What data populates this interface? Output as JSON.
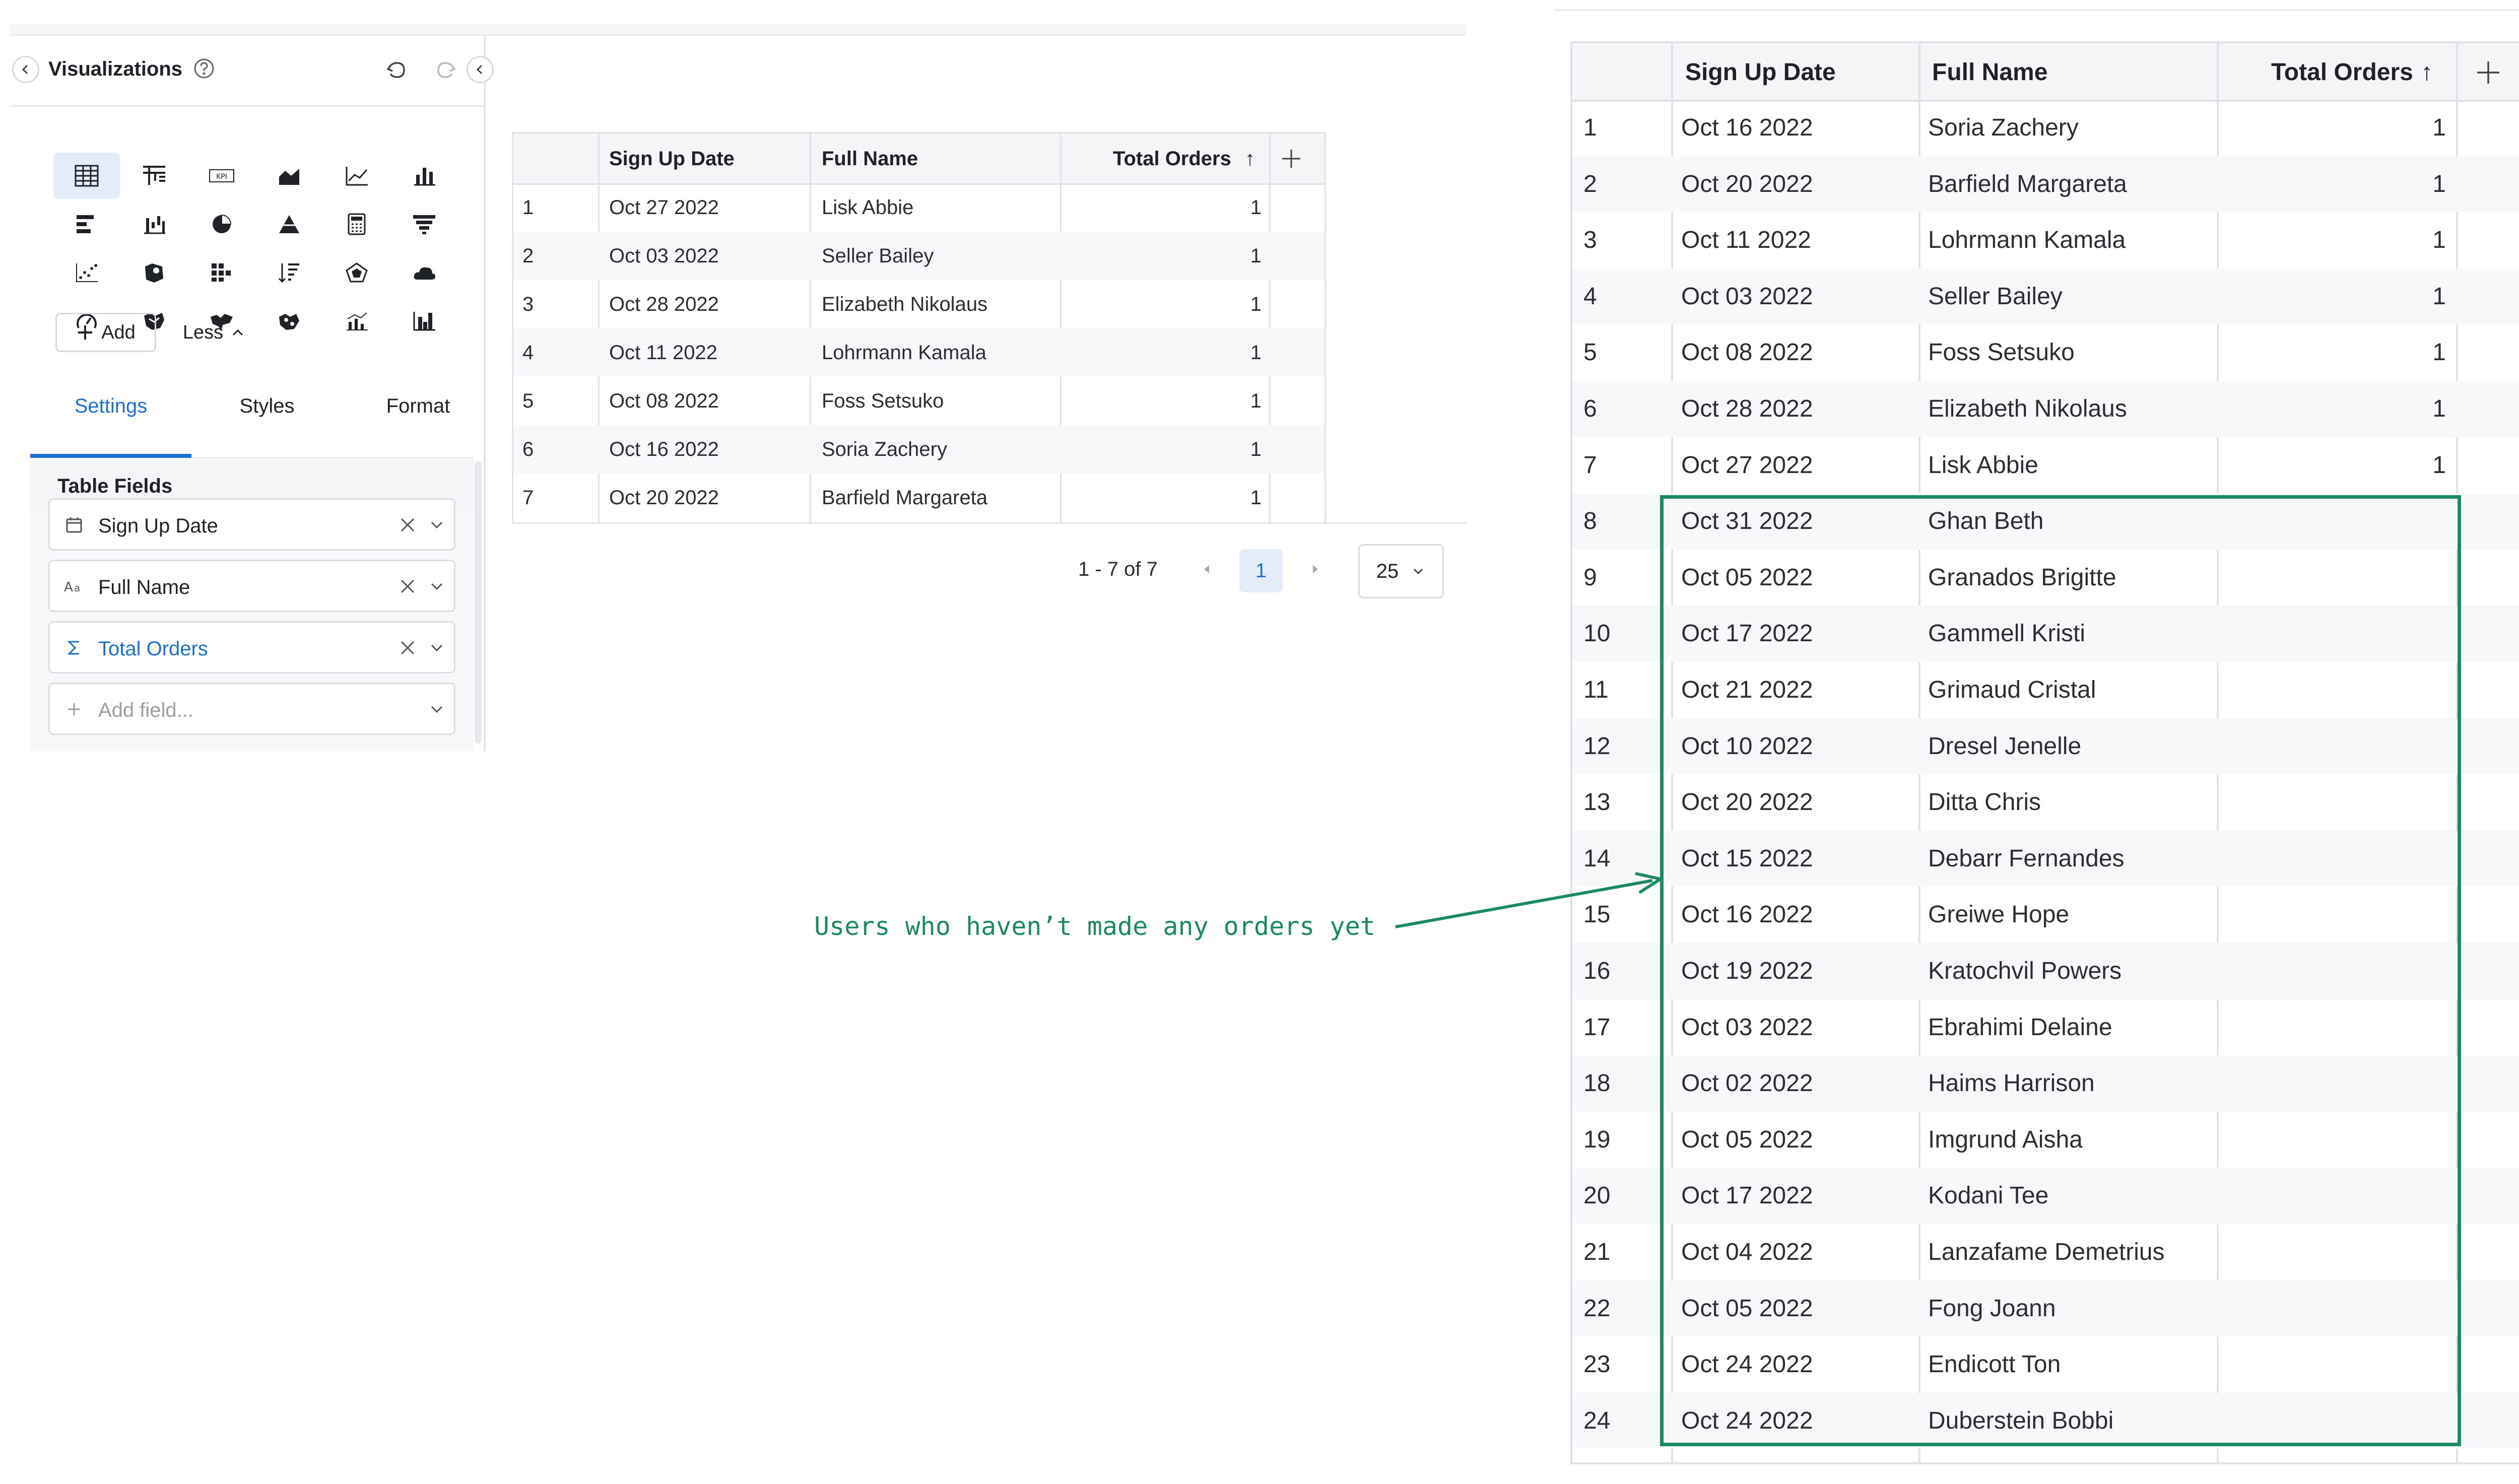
{
  "visualizations": {
    "title": "Visualizations",
    "icons": [
      "table-icon",
      "pivot-table-icon",
      "kpi-icon",
      "area-chart-icon",
      "line-chart-icon",
      "bar-chart-icon",
      "horizontal-bar-icon",
      "waterfall-icon",
      "pie-chart-icon",
      "pyramid-icon",
      "calculator-icon",
      "funnel-icon",
      "scatter-icon",
      "map-icon",
      "heatmap-icon",
      "sorted-bar-icon",
      "radar-icon",
      "word-cloud-icon",
      "gauge-icon",
      "map-region-icon",
      "world-map-icon",
      "bubble-map-icon",
      "combo-chart-icon",
      "histogram-icon"
    ],
    "add_label": "Add",
    "less_label": "Less",
    "tabs": [
      "Settings",
      "Styles",
      "Format"
    ],
    "active_tab": "Settings",
    "section_title": "Table Fields",
    "fields": [
      {
        "label": "Sign Up Date",
        "icon": "calendar-icon",
        "type": "dimension"
      },
      {
        "label": "Full Name",
        "icon": "text-type-icon",
        "type": "dimension"
      },
      {
        "label": "Total Orders",
        "icon": "sigma-icon",
        "type": "measure"
      }
    ],
    "add_field_placeholder": "Add field...",
    "accent": "#1f6fd1"
  },
  "center_table": {
    "columns": [
      "Sign Up Date",
      "Full Name",
      "Total Orders"
    ],
    "sort_indicator": "↑",
    "rows": [
      {
        "n": "1",
        "date": "Oct 27 2022",
        "name": "Lisk Abbie",
        "orders": "1"
      },
      {
        "n": "2",
        "date": "Oct 03 2022",
        "name": "Seller Bailey",
        "orders": "1"
      },
      {
        "n": "3",
        "date": "Oct 28 2022",
        "name": "Elizabeth Nikolaus",
        "orders": "1"
      },
      {
        "n": "4",
        "date": "Oct 11 2022",
        "name": "Lohrmann Kamala",
        "orders": "1"
      },
      {
        "n": "5",
        "date": "Oct 08 2022",
        "name": "Foss Setsuko",
        "orders": "1"
      },
      {
        "n": "6",
        "date": "Oct 16 2022",
        "name": "Soria Zachery",
        "orders": "1"
      },
      {
        "n": "7",
        "date": "Oct 20 2022",
        "name": "Barfield Margareta",
        "orders": "1"
      }
    ],
    "pagination": {
      "info": "1 - 7 of 7",
      "page": "1",
      "page_size": "25"
    }
  },
  "right_table": {
    "columns": [
      "Sign Up Date",
      "Full Name",
      "Total Orders"
    ],
    "sort_indicator": "↑",
    "rows": [
      {
        "n": "1",
        "date": "Oct 16 2022",
        "name": "Soria Zachery",
        "orders": "1"
      },
      {
        "n": "2",
        "date": "Oct 20 2022",
        "name": "Barfield Margareta",
        "orders": "1"
      },
      {
        "n": "3",
        "date": "Oct 11 2022",
        "name": "Lohrmann Kamala",
        "orders": "1"
      },
      {
        "n": "4",
        "date": "Oct 03 2022",
        "name": "Seller Bailey",
        "orders": "1"
      },
      {
        "n": "5",
        "date": "Oct 08 2022",
        "name": "Foss Setsuko",
        "orders": "1"
      },
      {
        "n": "6",
        "date": "Oct 28 2022",
        "name": "Elizabeth Nikolaus",
        "orders": "1"
      },
      {
        "n": "7",
        "date": "Oct 27 2022",
        "name": "Lisk Abbie",
        "orders": "1"
      },
      {
        "n": "8",
        "date": "Oct 31 2022",
        "name": "Ghan Beth",
        "orders": ""
      },
      {
        "n": "9",
        "date": "Oct 05 2022",
        "name": "Granados Brigitte",
        "orders": ""
      },
      {
        "n": "10",
        "date": "Oct 17 2022",
        "name": "Gammell Kristi",
        "orders": ""
      },
      {
        "n": "11",
        "date": "Oct 21 2022",
        "name": "Grimaud Cristal",
        "orders": ""
      },
      {
        "n": "12",
        "date": "Oct 10 2022",
        "name": "Dresel Jenelle",
        "orders": ""
      },
      {
        "n": "13",
        "date": "Oct 20 2022",
        "name": "Ditta Chris",
        "orders": ""
      },
      {
        "n": "14",
        "date": "Oct 15 2022",
        "name": "Debarr Fernandes",
        "orders": ""
      },
      {
        "n": "15",
        "date": "Oct 16 2022",
        "name": "Greiwe Hope",
        "orders": ""
      },
      {
        "n": "16",
        "date": "Oct 19 2022",
        "name": "Kratochvil Powers",
        "orders": ""
      },
      {
        "n": "17",
        "date": "Oct 03 2022",
        "name": "Ebrahimi Delaine",
        "orders": ""
      },
      {
        "n": "18",
        "date": "Oct 02 2022",
        "name": "Haims Harrison",
        "orders": ""
      },
      {
        "n": "19",
        "date": "Oct 05 2022",
        "name": "Imgrund Aisha",
        "orders": ""
      },
      {
        "n": "20",
        "date": "Oct 17 2022",
        "name": "Kodani Tee",
        "orders": ""
      },
      {
        "n": "21",
        "date": "Oct 04 2022",
        "name": "Lanzafame Demetrius",
        "orders": ""
      },
      {
        "n": "22",
        "date": "Oct 05 2022",
        "name": "Fong Joann",
        "orders": ""
      },
      {
        "n": "23",
        "date": "Oct 24 2022",
        "name": "Endicott Ton",
        "orders": ""
      },
      {
        "n": "24",
        "date": "Oct 24 2022",
        "name": "Duberstein Bobbi",
        "orders": ""
      }
    ]
  },
  "annotation": {
    "text": "Users who haven’t made any orders yet",
    "color": "#1b8a63"
  }
}
